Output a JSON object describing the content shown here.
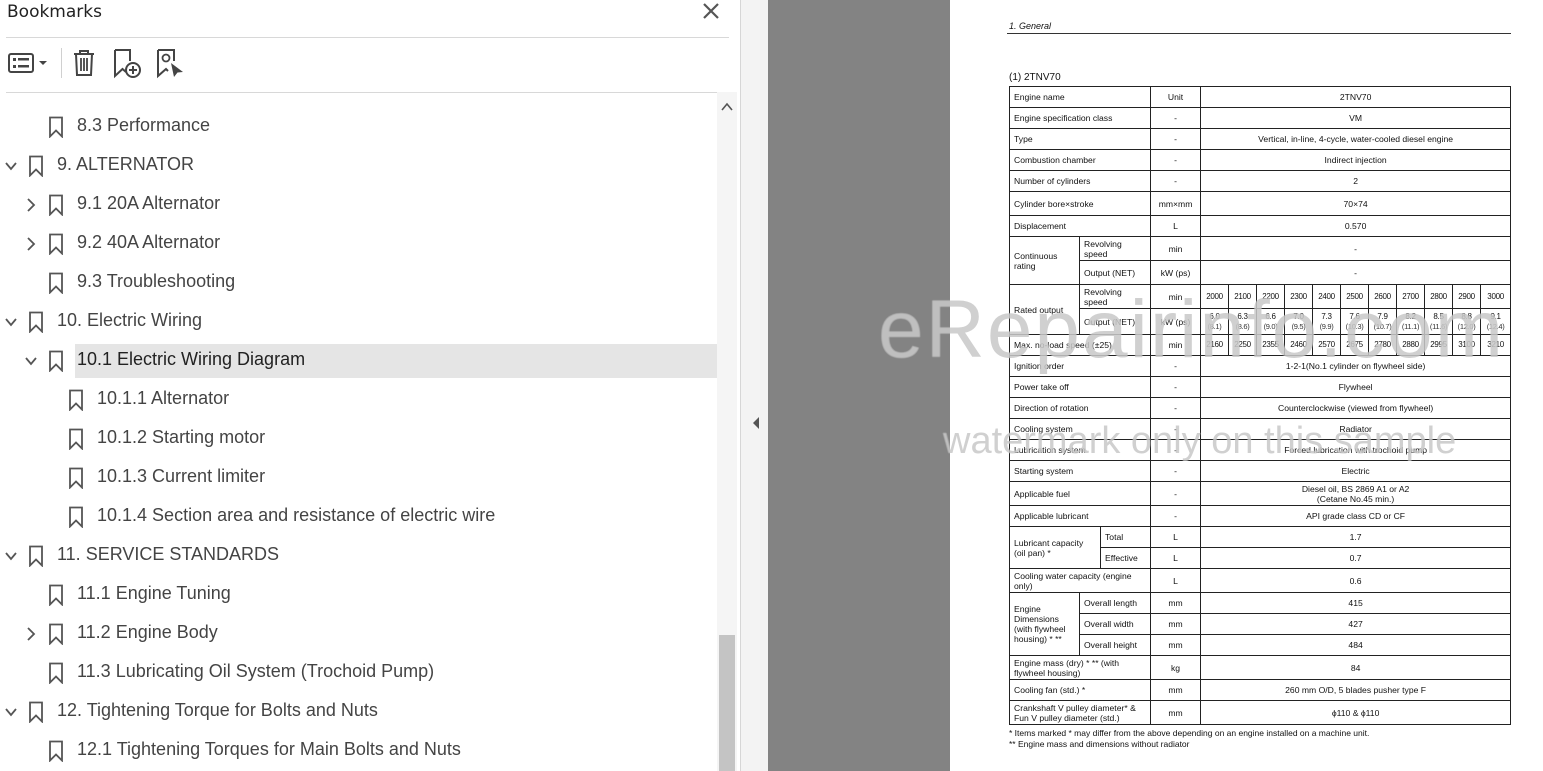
{
  "panel": {
    "title": "Bookmarks"
  },
  "toolbar": {
    "options_icon": "list-options-icon",
    "delete_icon": "trash-icon",
    "new_bookmark_icon": "add-bookmark-icon",
    "find_bookmark_icon": "find-current-bookmark-icon"
  },
  "bookmarks": [
    {
      "label": "8.3 Performance",
      "level": 1,
      "expander": "none"
    },
    {
      "label": "9. ALTERNATOR",
      "level": 0,
      "expander": "expanded"
    },
    {
      "label": "9.1 20A Alternator",
      "level": 1,
      "expander": "collapsed"
    },
    {
      "label": "9.2 40A Alternator",
      "level": 1,
      "expander": "collapsed"
    },
    {
      "label": "9.3 Troubleshooting",
      "level": 1,
      "expander": "none"
    },
    {
      "label": "10. Electric Wiring",
      "level": 0,
      "expander": "expanded"
    },
    {
      "label": "10.1 Electric Wiring Diagram",
      "level": 1,
      "expander": "expanded",
      "selected": true
    },
    {
      "label": "10.1.1 Alternator",
      "level": 2,
      "expander": "none"
    },
    {
      "label": "10.1.2 Starting motor",
      "level": 2,
      "expander": "none"
    },
    {
      "label": "10.1.3 Current limiter",
      "level": 2,
      "expander": "none"
    },
    {
      "label": "10.1.4 Section area and resistance of electric wire",
      "level": 2,
      "expander": "none"
    },
    {
      "label": "11. SERVICE STANDARDS",
      "level": 0,
      "expander": "expanded"
    },
    {
      "label": "11.1 Engine Tuning",
      "level": 1,
      "expander": "none"
    },
    {
      "label": "11.2 Engine Body",
      "level": 1,
      "expander": "collapsed"
    },
    {
      "label": "11.3 Lubricating Oil System (Trochoid Pump)",
      "level": 1,
      "expander": "none"
    },
    {
      "label": "12. Tightening Torque for Bolts and Nuts",
      "level": 0,
      "expander": "expanded"
    },
    {
      "label": "12.1 Tightening Torques for Main Bolts and Nuts",
      "level": 1,
      "expander": "none"
    }
  ],
  "document": {
    "header": "1. General",
    "table_title": "(1) 2TNV70",
    "rows": {
      "engine_name": [
        "Engine name",
        "Unit",
        "2TNV70"
      ],
      "spec_class": [
        "Engine specification class",
        "-",
        "VM"
      ],
      "type": [
        "Type",
        "-",
        "Vertical, in-line, 4-cycle, water-cooled diesel engine"
      ],
      "combustion": [
        "Combustion chamber",
        "-",
        "Indirect injection"
      ],
      "cylinders": [
        "Number of cylinders",
        "-",
        "2"
      ],
      "bore": [
        "Cylinder bore×stroke",
        "mm×mm",
        "70×74"
      ],
      "displacement": [
        "Displacement",
        "L",
        "0.570"
      ],
      "continuous": {
        "label": "Continuous rating",
        "sub1": "Revolving speed",
        "unit1": "min",
        "val1": "-",
        "sub2": "Output (NET)",
        "unit2": "kW (ps)",
        "val2": "-"
      },
      "rated": {
        "label": "Rated output",
        "sub1": "Revolving speed",
        "unit1": "min",
        "speeds": [
          "2000",
          "2100",
          "2200",
          "2300",
          "2400",
          "2500",
          "2600",
          "2700",
          "2800",
          "2900",
          "3000"
        ],
        "sub2": "Output (NET)",
        "unit2": "kW (ps)",
        "kw": [
          "6.0",
          "6.3",
          "6.6",
          "7.0",
          "7.3",
          "7.6",
          "7.9",
          "8.2",
          "8.5",
          "8.8",
          "9.1"
        ],
        "ps": [
          "(8.1)",
          "(8.6)",
          "(9.0)",
          "(9.5)",
          "(9.9)",
          "(10.3)",
          "(10.7)",
          "(11.1)",
          "(11.6)",
          "(12.0)",
          "(12.4)"
        ]
      },
      "noload": {
        "label": "Max. no-load speed (±25)",
        "unit": "min",
        "vals": [
          "2160",
          "2250",
          "2355",
          "2460",
          "2570",
          "2675",
          "2780",
          "2880",
          "2995",
          "3100",
          "3210"
        ]
      },
      "ignition": [
        "Ignition order",
        "-",
        "1-2-1(No.1 cylinder on flywheel side)"
      ],
      "pto": [
        "Power take off",
        "-",
        "Flywheel"
      ],
      "rotation": [
        "Direction of rotation",
        "-",
        "Counterclockwise (viewed from flywheel)"
      ],
      "cooling": [
        "Cooling system",
        "-",
        "Radiator"
      ],
      "lube": [
        "Lubrication system",
        "-",
        "Forced lubrication with trochoid pump"
      ],
      "starting": [
        "Starting system",
        "-",
        "Electric"
      ],
      "fuel": [
        "Applicable fuel",
        "-",
        "Diesel oil, BS 2869 A1 or A2",
        "(Cetane No.45 min.)"
      ],
      "lubricant": [
        "Applicable lubricant",
        "-",
        "API grade class CD or CF"
      ],
      "lubcap": {
        "label": "Lubricant capacity (oil pan) *",
        "sub1": "Total",
        "unit1": "L",
        "val1": "1.7",
        "sub2": "Effective",
        "unit2": "L",
        "val2": "0.7"
      },
      "coolwater": [
        "Cooling water capacity (engine only)",
        "L",
        "0.6"
      ],
      "dims": {
        "label": "Engine Dimensions (with flywheel housing) * **",
        "sub1": "Overall length",
        "val1": "415",
        "sub2": "Overall width",
        "val2": "427",
        "sub3": "Overall height",
        "val3": "484",
        "unit": "mm"
      },
      "mass": [
        "Engine mass (dry) * ** (with flywheel housing)",
        "kg",
        "84"
      ],
      "fan": [
        "Cooling fan (std.) *",
        "mm",
        "260 mm O/D, 5 blades pusher type F"
      ],
      "pulley": [
        "Crankshaft V pulley diameter* & Fun V pulley diameter (std.)",
        "mm",
        "ϕ110 & ϕ110"
      ]
    },
    "footnote1": "* Items marked * may differ from the above depending on an engine installed on a machine unit.",
    "footnote2": "** Engine mass and dimensions without radiator"
  },
  "watermark": {
    "line1": "eRepairinfo.com",
    "line2": "watermark only on this sample"
  }
}
